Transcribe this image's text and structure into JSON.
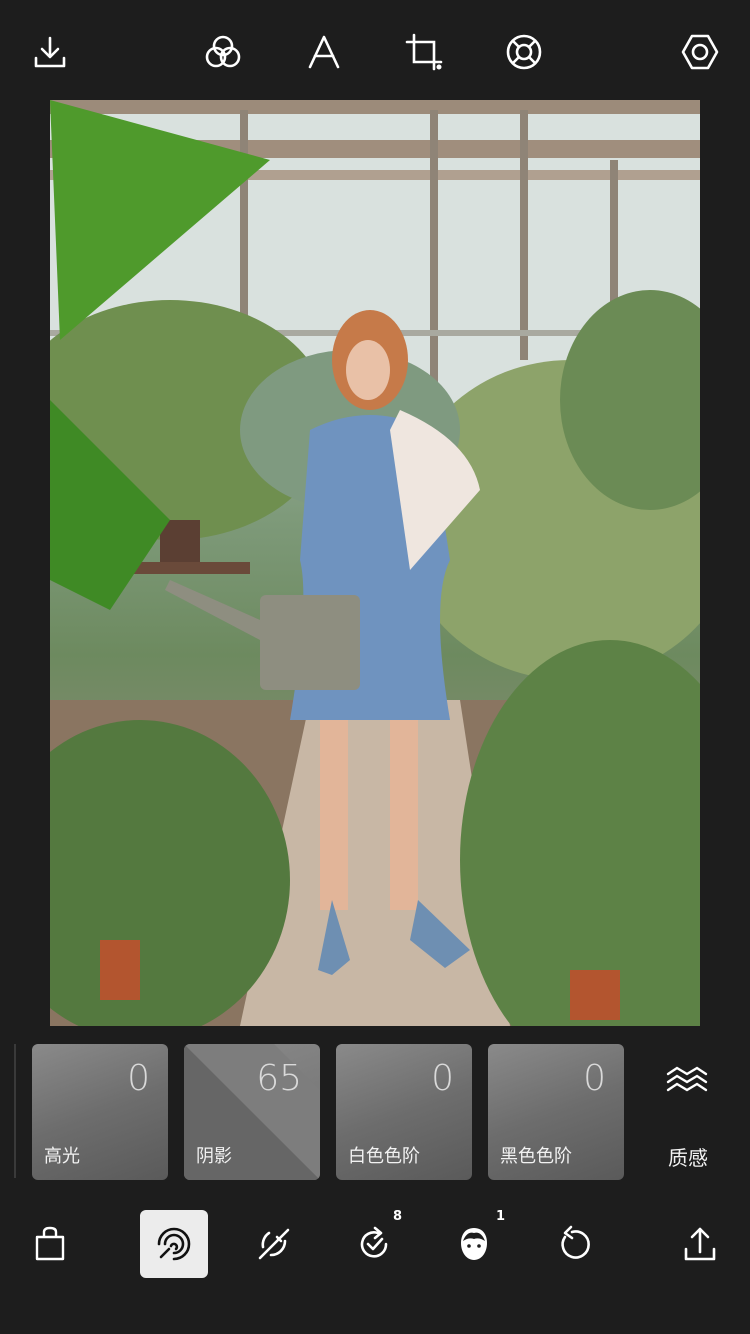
{
  "top_toolbar": {
    "icons": [
      "download-icon",
      "filters-icon",
      "text-icon",
      "crop-icon",
      "lifebuoy-icon",
      "settings-icon"
    ]
  },
  "photo": {
    "subject": "woman with watering can in greenhouse"
  },
  "adjustments": [
    {
      "value": "0",
      "label": "高光"
    },
    {
      "value": "65",
      "label": "阴影"
    },
    {
      "value": "0",
      "label": "白色色阶"
    },
    {
      "value": "0",
      "label": "黑色色阶"
    }
  ],
  "texture": {
    "label": "质感"
  },
  "bottom_toolbar": {
    "redo_badge": "8",
    "face_badge": "1"
  },
  "colors": {
    "background": "#1d1d1d",
    "card": "#6d6d6d",
    "selected_tool": "#ececec"
  }
}
